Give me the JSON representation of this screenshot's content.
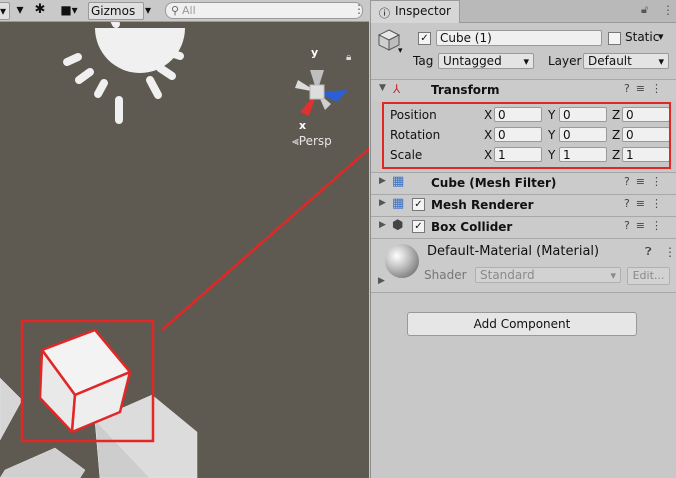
{
  "scene": {
    "toolbar": {
      "gizmos_label": "Gizmos",
      "search_placeholder": "All"
    },
    "persp_label": "Persp",
    "gizmo_axes": {
      "y": "y",
      "x": "x"
    }
  },
  "inspector": {
    "tab_label": "Inspector",
    "object": {
      "enabled": "✓",
      "name": "Cube (1)",
      "static_label": "Static"
    },
    "tag": {
      "label": "Tag",
      "value": "Untagged"
    },
    "layer": {
      "label": "Layer",
      "value": "Default"
    },
    "transform": {
      "title": "Transform",
      "rows": [
        {
          "label": "Position",
          "x": "0",
          "y": "0",
          "z": "0"
        },
        {
          "label": "Rotation",
          "x": "0",
          "y": "0",
          "z": "0"
        },
        {
          "label": "Scale",
          "x": "1",
          "y": "1",
          "z": "1"
        }
      ],
      "axis_x": "X",
      "axis_y": "Y",
      "axis_z": "Z"
    },
    "components": [
      {
        "title": "Cube (Mesh Filter)"
      },
      {
        "title": "Mesh Renderer",
        "enabled": "✓"
      },
      {
        "title": "Box Collider",
        "enabled": "✓"
      }
    ],
    "material": {
      "title": "Default-Material (Material)",
      "shader_label": "Shader",
      "shader_value": "Standard",
      "edit_label": "Edit..."
    },
    "add_component_label": "Add Component"
  },
  "colors": {
    "highlight": "#e32626",
    "scene_bg": "#5f5a51",
    "axis_x": "#e03030",
    "axis_z": "#2a5fd6"
  }
}
